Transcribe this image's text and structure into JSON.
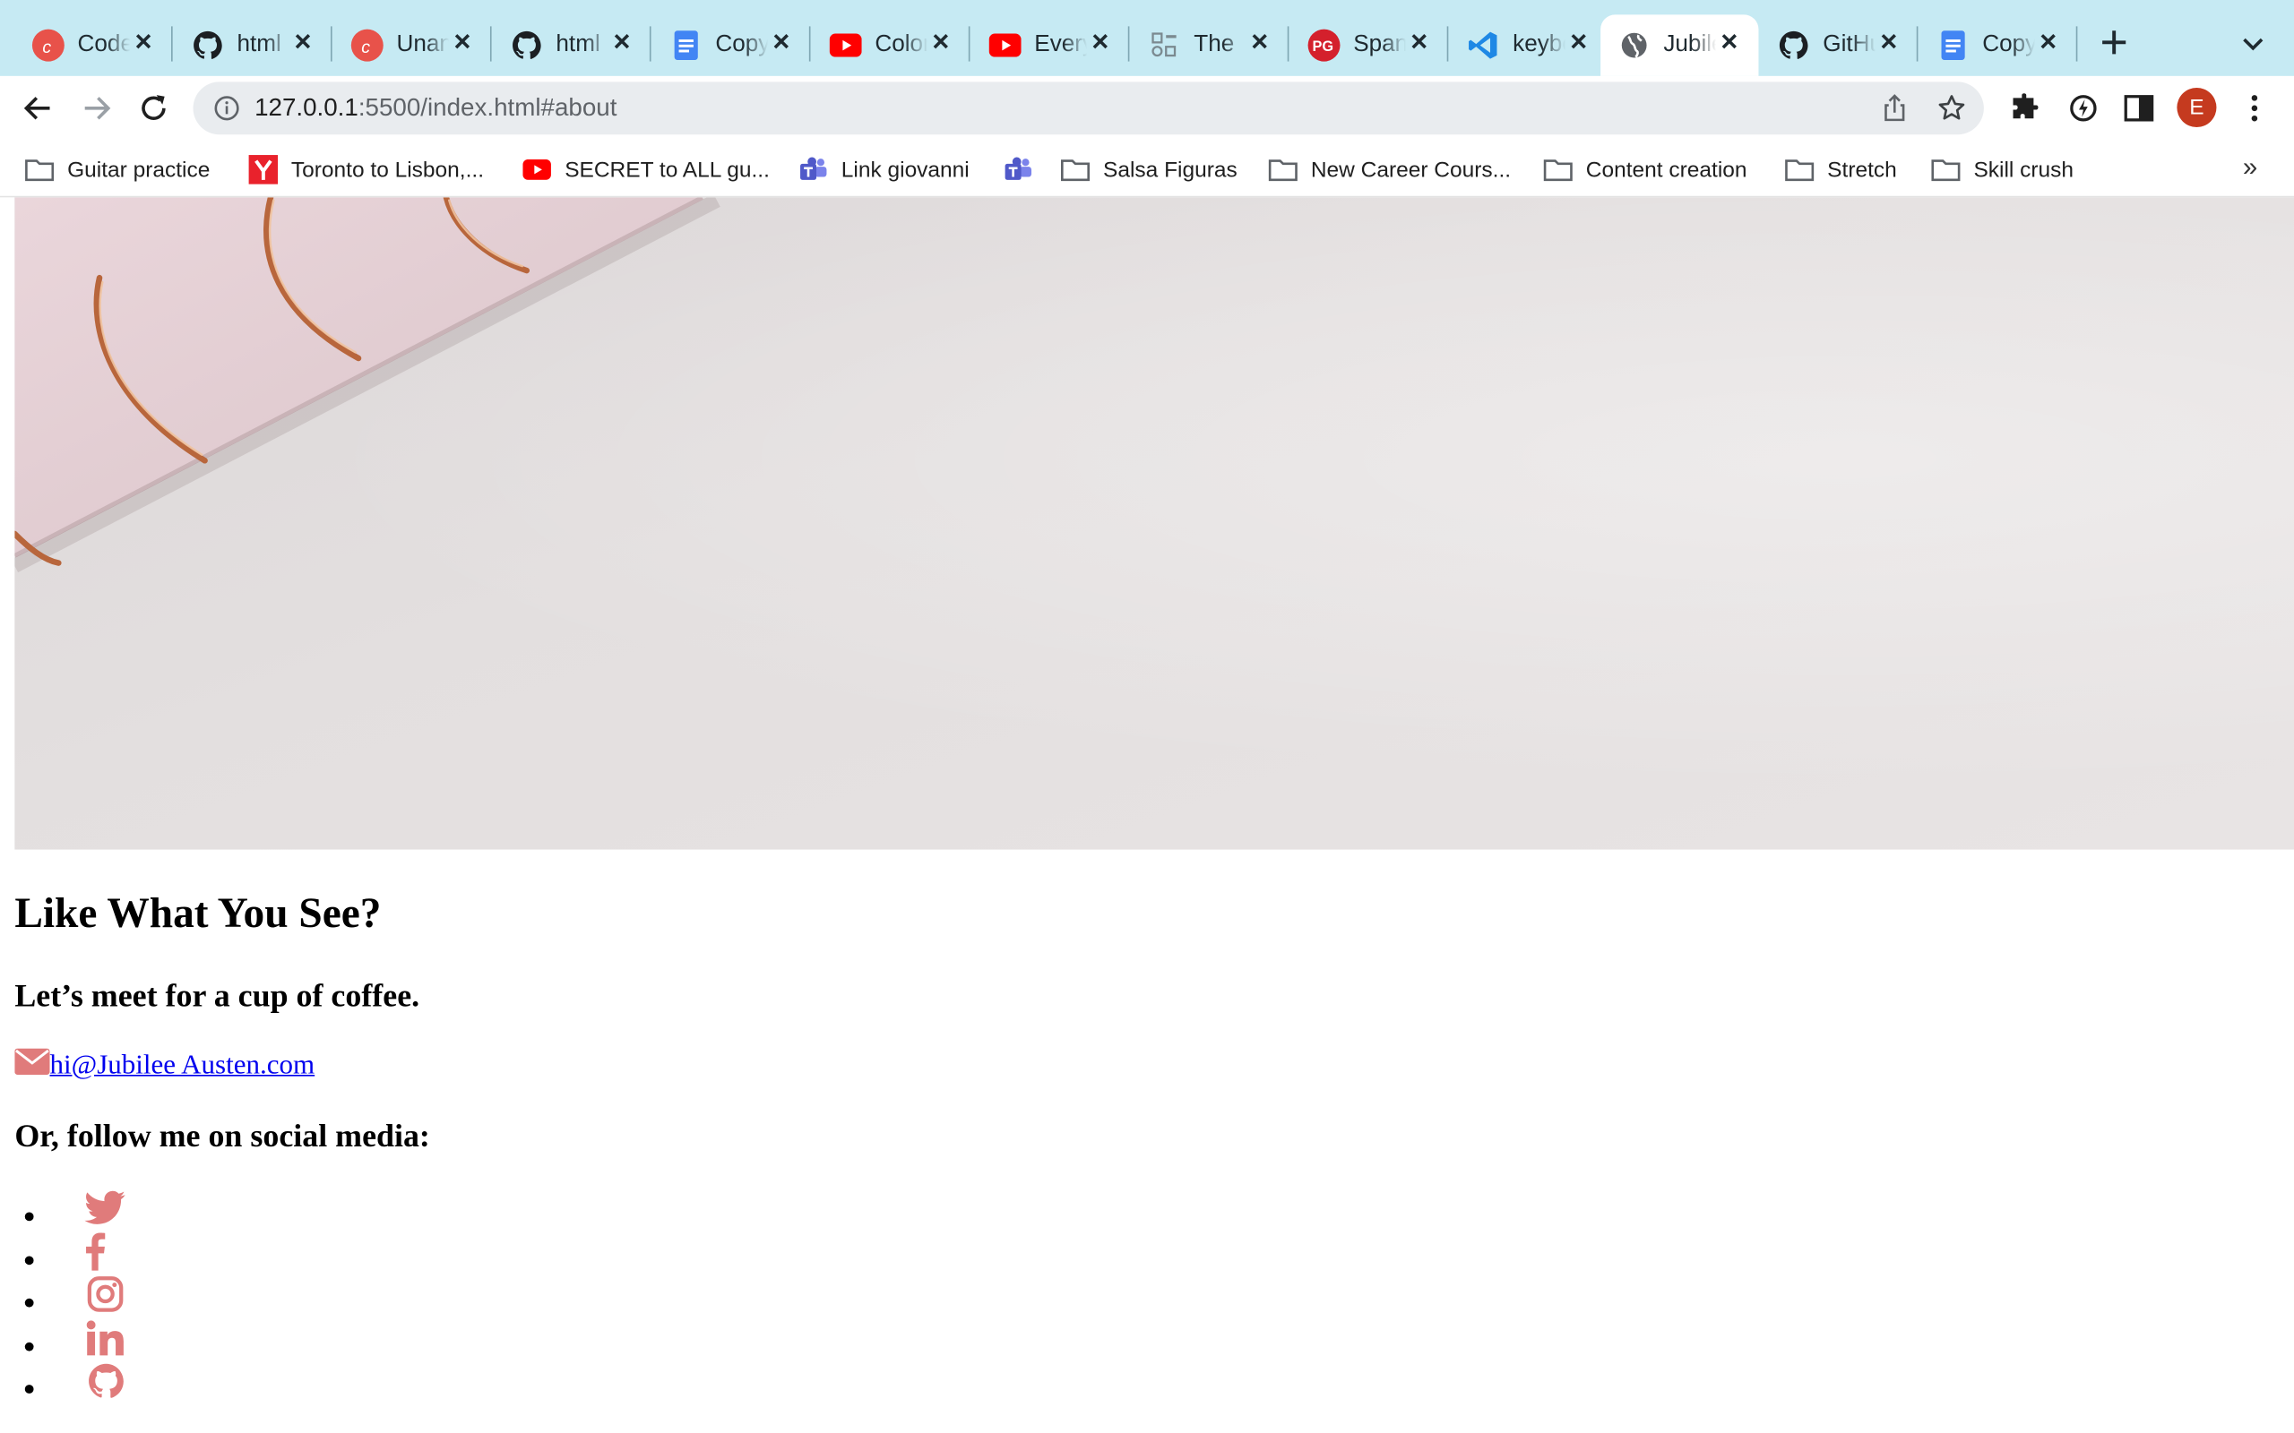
{
  "browser": {
    "tabs": [
      {
        "title": "Codecademy",
        "icon": "codecademy-icon",
        "active": false
      },
      {
        "title": "html",
        "icon": "github-icon",
        "active": false
      },
      {
        "title": "Unanswered",
        "icon": "codecademy-icon",
        "active": false
      },
      {
        "title": "html",
        "icon": "github-icon",
        "active": false
      },
      {
        "title": "Copy",
        "icon": "google-docs-icon",
        "active": false
      },
      {
        "title": "Color",
        "icon": "youtube-icon",
        "active": false
      },
      {
        "title": "Every",
        "icon": "youtube-icon",
        "active": false
      },
      {
        "title": "The",
        "icon": "shapes-icon",
        "active": false
      },
      {
        "title": "Spanish",
        "icon": "pg-icon",
        "active": false
      },
      {
        "title": "keyboard",
        "icon": "vscode-icon",
        "active": false
      },
      {
        "title": "Jubilee",
        "icon": "globe-icon",
        "active": true
      },
      {
        "title": "GitHub",
        "icon": "github-icon",
        "active": false
      },
      {
        "title": "Copy",
        "icon": "google-docs-icon",
        "active": false
      }
    ],
    "address_bar": {
      "url_host": "127.0.0.1",
      "url_rest": ":5500/index.html#about"
    },
    "avatar_initial": "E",
    "bookmarks": [
      {
        "label": "Guitar practice",
        "icon": "folder-icon"
      },
      {
        "label": "Toronto to Lisbon,...",
        "icon": "yelp-icon"
      },
      {
        "label": "SECRET to ALL gu...",
        "icon": "youtube-icon"
      },
      {
        "label": "Link giovanni",
        "icon": "teams-icon"
      },
      {
        "label": "",
        "icon": "teams-icon"
      },
      {
        "label": "Salsa Figuras",
        "icon": "folder-icon"
      },
      {
        "label": "New Career Cours...",
        "icon": "folder-icon"
      },
      {
        "label": "Content creation",
        "icon": "folder-icon"
      },
      {
        "label": "Stretch",
        "icon": "folder-icon"
      },
      {
        "label": "Skill crush",
        "icon": "folder-icon"
      }
    ],
    "bookmarks_overflow": "»"
  },
  "page": {
    "heading": "Like What You See?",
    "subheading": "Let’s meet for a cup of coffee.",
    "email": "hi@Jubilee Austen.com",
    "follow_heading": "Or, follow me on social media:",
    "social_icons": [
      "twitter-icon",
      "facebook-icon",
      "instagram-icon",
      "linkedin-icon",
      "github-icon"
    ],
    "icon_color": "#e07b7b"
  },
  "colors": {
    "tabstrip": "#c6eaf3",
    "link": "#0000ee",
    "avatar": "#c53a1f"
  }
}
